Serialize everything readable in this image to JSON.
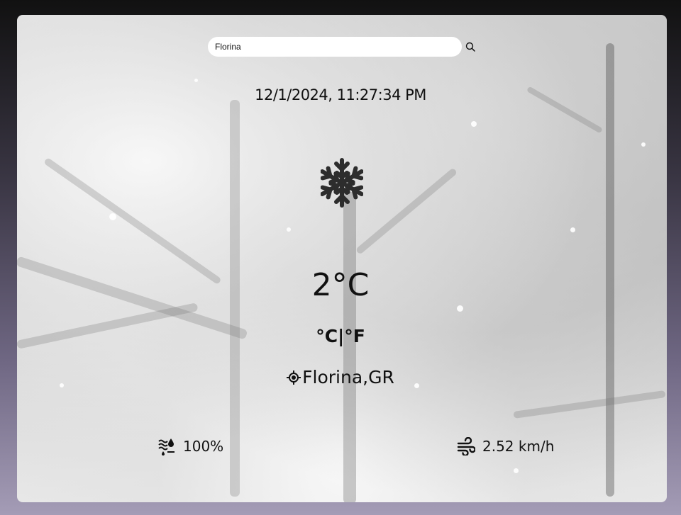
{
  "search": {
    "value": "Florina",
    "icon": "search-icon"
  },
  "datetime": "12/1/2024, 11:27:34 PM",
  "weather": {
    "icon": "snowflake-icon",
    "temperature": "2°C",
    "unit_celsius": "°C",
    "unit_separator": "|",
    "unit_fahrenheit": "°F"
  },
  "location": {
    "icon": "location-target-icon",
    "text": "Florina,GR"
  },
  "humidity": {
    "icon": "humidity-icon",
    "value": "100%"
  },
  "wind": {
    "icon": "wind-icon",
    "value": "2.52 km/h"
  }
}
